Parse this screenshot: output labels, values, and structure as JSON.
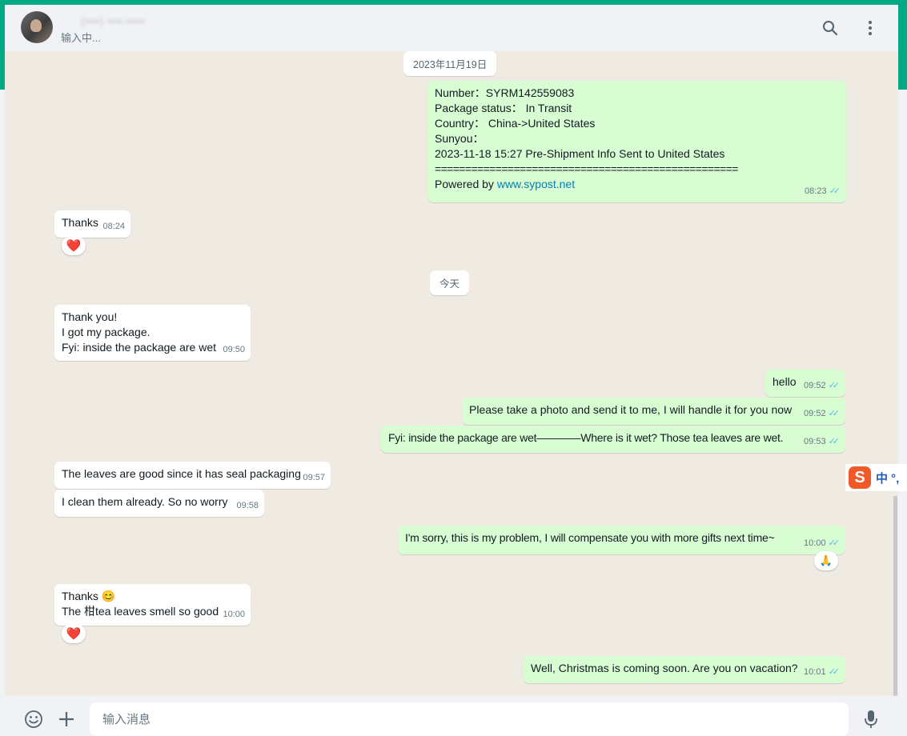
{
  "header": {
    "contact_name": "(•••) •••-••••",
    "status": "输入中...",
    "search_icon": "search-icon",
    "menu_icon": "menu-dots-icon"
  },
  "chat": {
    "date1": "2023年11月19日",
    "date2": "今天",
    "tracking": {
      "lines": [
        "Number：SYRM142559083",
        "Package status：  In Transit",
        "Country：  China->United States",
        "Sunyou：",
        "2023-11-18 15:27 Pre-Shipment Info Sent to United States",
        "=================================================="
      ],
      "powered_prefix": "Powered by ",
      "powered_link": "www.sypost.net",
      "time": "08:23"
    },
    "m_thanks": {
      "text": "Thanks",
      "time": "08:24",
      "reaction": "❤️"
    },
    "m_thankyou": {
      "lines": [
        "Thank you!",
        "I got my package.",
        "Fyi:  inside the package are wet"
      ],
      "time": "09:50"
    },
    "m_hello": {
      "text": "hello",
      "time": "09:52"
    },
    "m_photo": {
      "text": "Please take a photo and send it to me, I will handle it for you now",
      "time": "09:52"
    },
    "m_fyi": {
      "text": "Fyi:  inside the package are wet————Where is it wet? Those tea leaves are wet.",
      "time": "09:53"
    },
    "m_leaves": {
      "text": "The leaves are good since it has seal packaging",
      "time": "09:57"
    },
    "m_clean": {
      "text": "I clean them already.  So no worry",
      "time": "09:58"
    },
    "m_sorry": {
      "text": "I'm sorry, this is my problem, I will compensate you with more gifts next time~",
      "time": "10:00",
      "reaction": "🙏"
    },
    "m_thanks2": {
      "line1": "Thanks 😊",
      "line2": "The 柑tea leaves smell so good",
      "time": "10:00",
      "reaction": "❤️"
    },
    "m_christmas": {
      "text": "Well, Christmas is coming soon. Are you on vacation?",
      "time": "10:01"
    },
    "read_ticks": "✓✓"
  },
  "composer": {
    "placeholder": "输入消息",
    "emoji_icon": "emoji-icon",
    "attach_icon": "plus-icon",
    "mic_icon": "microphone-icon"
  },
  "ime": {
    "logo": "S",
    "text": "中 °,"
  },
  "colors": {
    "accent": "#00a884",
    "outgoing": "#d9fdd3",
    "incoming": "#ffffff",
    "ticks": "#53bdeb",
    "wallpaper": "#efeae2"
  }
}
